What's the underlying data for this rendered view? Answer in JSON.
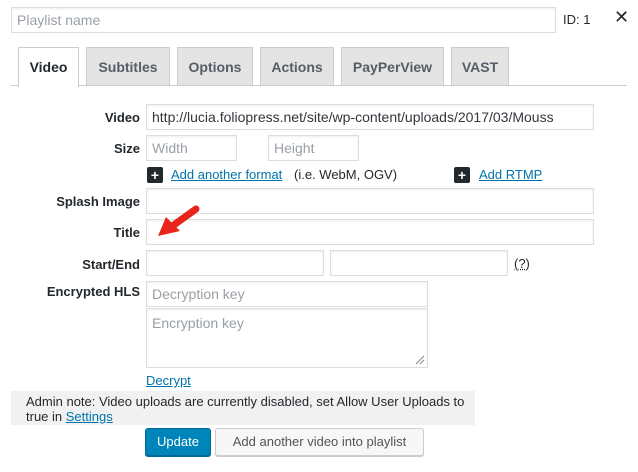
{
  "header": {
    "playlist_placeholder": "Playlist name",
    "id_label": "ID: 1",
    "close_glyph": "✕"
  },
  "tabs": [
    {
      "label": "Video",
      "active": true
    },
    {
      "label": "Subtitles",
      "active": false
    },
    {
      "label": "Options",
      "active": false
    },
    {
      "label": "Actions",
      "active": false
    },
    {
      "label": "PayPerView",
      "active": false
    },
    {
      "label": "VAST",
      "active": false
    }
  ],
  "form": {
    "video_label": "Video",
    "video_value": "http://lucia.foliopress.net/site/wp-content/uploads/2017/03/Mouss",
    "size_label": "Size",
    "width_placeholder": "Width",
    "height_placeholder": "Height",
    "add_format_link": "Add another format",
    "add_format_hint": "(i.e. WebM, OGV)",
    "add_rtmp_link": "Add RTMP",
    "splash_label": "Splash Image",
    "title_label": "Title",
    "startend_label": "Start/End",
    "help_glyph": "(?)",
    "encrypted_label": "Encrypted HLS",
    "decryption_placeholder": "Decryption key",
    "encryption_placeholder": "Encryption key",
    "decrypt_link": "Decrypt",
    "plus_glyph": "+"
  },
  "note": {
    "text": "Admin note: Video uploads are currently disabled, set Allow User Uploads to true in",
    "settings_link": "Settings"
  },
  "footer": {
    "update_button": "Update",
    "add_video_button": "Add another video into playlist"
  },
  "colors": {
    "primary": "#0085ba",
    "link": "#0073aa",
    "arrow": "#e8241b",
    "note_bg": "#f1f1f1"
  }
}
